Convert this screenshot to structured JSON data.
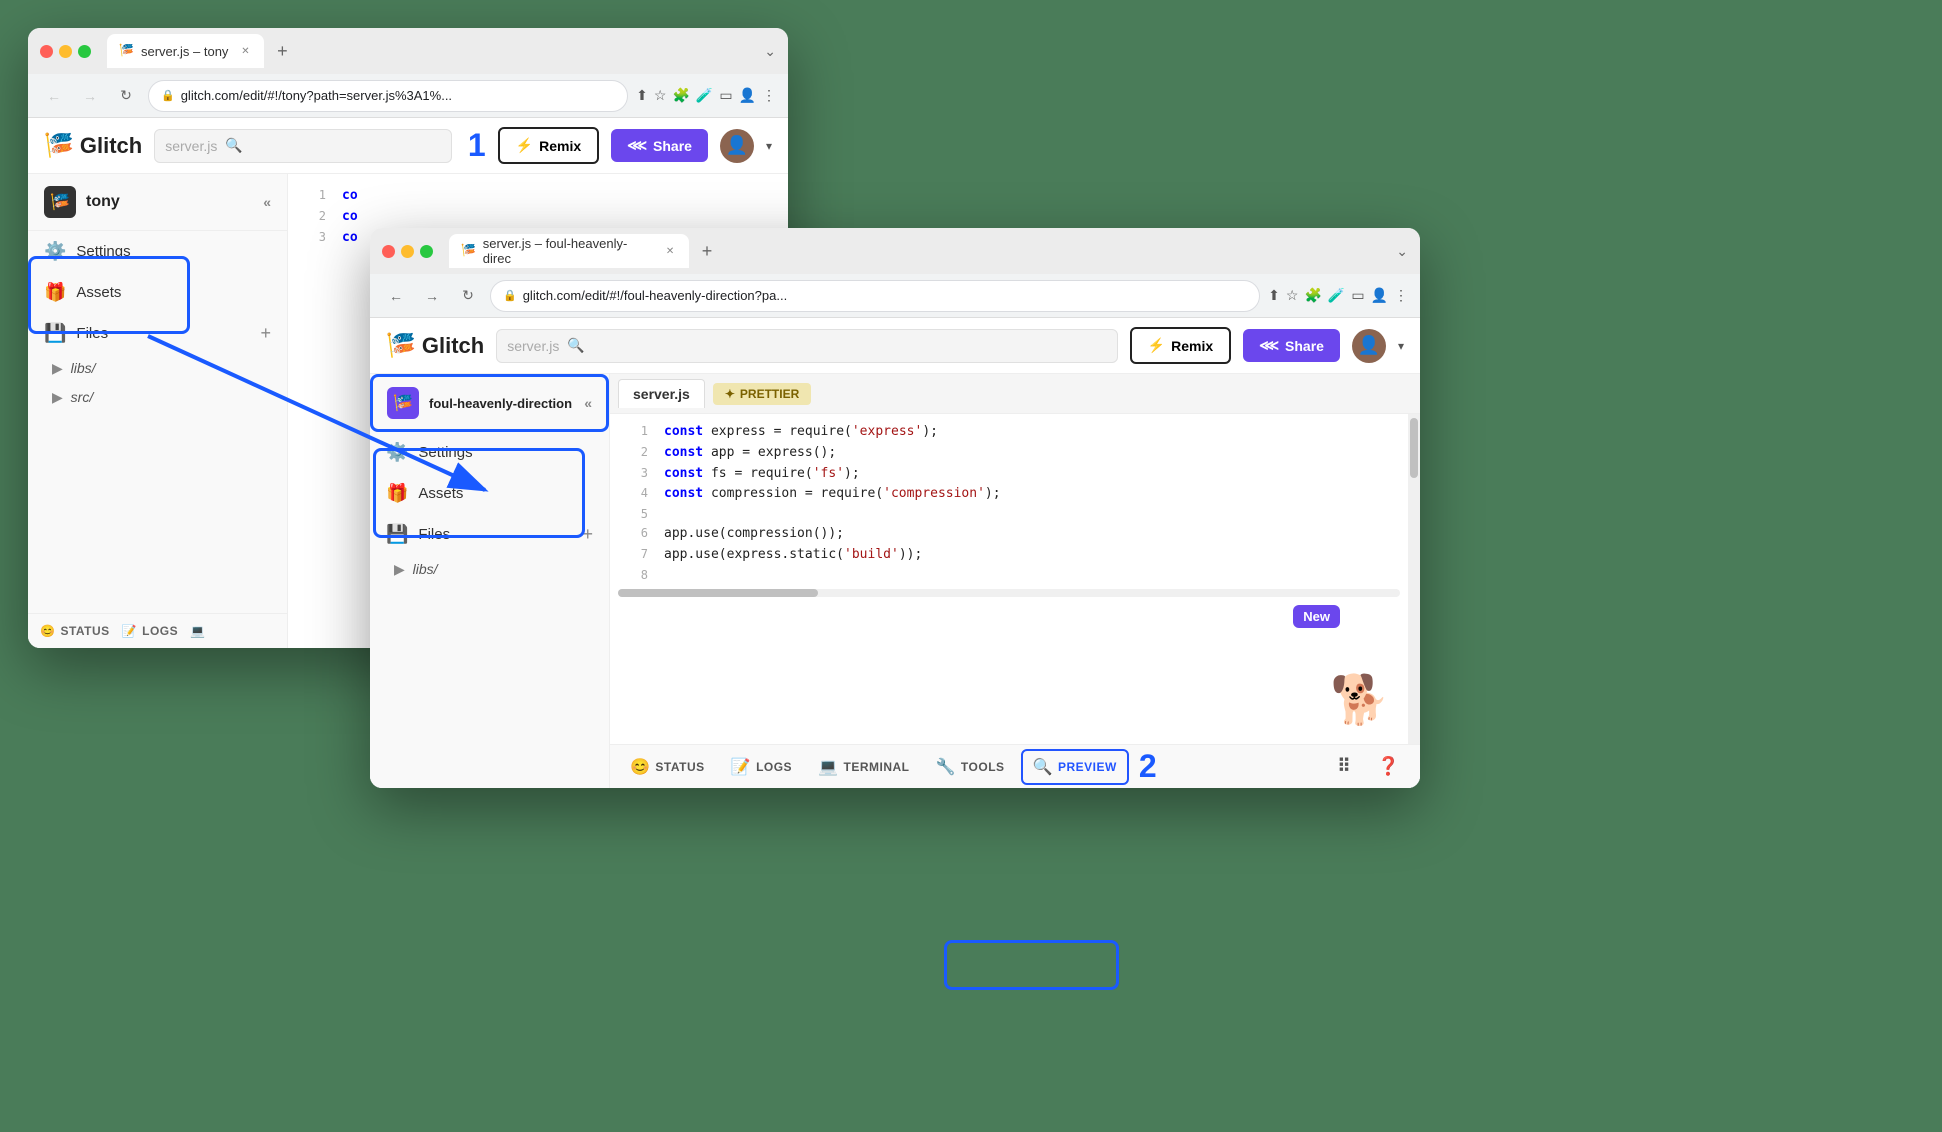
{
  "background_color": "#4a7c59",
  "window_back": {
    "title": "server.js – tony",
    "tab_label": "server.js – tony",
    "address": "glitch.com/edit/#!/tony?path=server.js%3A1%...",
    "project_name": "tony",
    "search_placeholder": "server.js",
    "btn_remix": "Remix",
    "btn_share": "Share",
    "sidebar_items": [
      {
        "icon": "⚙️",
        "label": "Settings"
      },
      {
        "icon": "🎁",
        "label": "Assets"
      },
      {
        "icon": "💾",
        "label": "Files"
      }
    ],
    "tree_items": [
      "libs/",
      "src/"
    ],
    "footer_items": [
      "STATUS",
      "LOGS"
    ],
    "code_lines": [
      {
        "num": "1",
        "content": "co"
      },
      {
        "num": "2",
        "content": "co"
      },
      {
        "num": "3",
        "content": "co"
      }
    ]
  },
  "window_front": {
    "title": "server.js – foul-heavenly-direc",
    "tab_label": "server.js – foul-heavenly-direc",
    "address": "glitch.com/edit/#!/foul-heavenly-direction?pa...",
    "project_name": "foul-heavenly-direction",
    "search_placeholder": "server.js",
    "btn_remix": "Remix",
    "btn_share": "Share",
    "editor_tab": "server.js",
    "prettier_label": "✦ PRETTIER",
    "sidebar_items": [
      {
        "icon": "⚙️",
        "label": "Settings"
      },
      {
        "icon": "🎁",
        "label": "Assets"
      },
      {
        "icon": "💾",
        "label": "Files"
      }
    ],
    "tree_items": [
      "libs/"
    ],
    "footer_items": [
      {
        "icon": "😊",
        "label": "STATUS"
      },
      {
        "icon": "📝",
        "label": "LOGS"
      },
      {
        "icon": "💻",
        "label": "TERMINAL"
      },
      {
        "icon": "🔧",
        "label": "TOOLS"
      },
      {
        "icon": "🔍",
        "label": "PREVIEW"
      }
    ],
    "code": [
      {
        "num": "1",
        "parts": [
          {
            "type": "kw-const",
            "text": "const"
          },
          {
            "type": "kw-plain",
            "text": " express = require("
          },
          {
            "type": "kw-string",
            "text": "'express'"
          },
          {
            "type": "kw-plain",
            "text": ");"
          }
        ]
      },
      {
        "num": "2",
        "parts": [
          {
            "type": "kw-const",
            "text": "const"
          },
          {
            "type": "kw-plain",
            "text": " app = express();"
          }
        ]
      },
      {
        "num": "3",
        "parts": [
          {
            "type": "kw-const",
            "text": "const"
          },
          {
            "type": "kw-plain",
            "text": " fs = require("
          },
          {
            "type": "kw-string",
            "text": "'fs'"
          },
          {
            "type": "kw-plain",
            "text": ");"
          }
        ]
      },
      {
        "num": "4",
        "parts": [
          {
            "type": "kw-const",
            "text": "const"
          },
          {
            "type": "kw-plain",
            "text": " compression = require("
          },
          {
            "type": "kw-string",
            "text": "'compression'"
          },
          {
            "type": "kw-plain",
            "text": ");"
          }
        ]
      },
      {
        "num": "5",
        "parts": []
      },
      {
        "num": "6",
        "parts": [
          {
            "type": "kw-plain",
            "text": "app.use(compression());"
          }
        ]
      },
      {
        "num": "7",
        "parts": [
          {
            "type": "kw-plain",
            "text": "app.use(express.static("
          },
          {
            "type": "kw-string",
            "text": "'build'"
          },
          {
            "type": "kw-plain",
            "text": "));"
          }
        ]
      },
      {
        "num": "8",
        "parts": []
      }
    ],
    "new_badge": "New"
  },
  "annotations": {
    "number_1": "1",
    "number_2": "2"
  }
}
